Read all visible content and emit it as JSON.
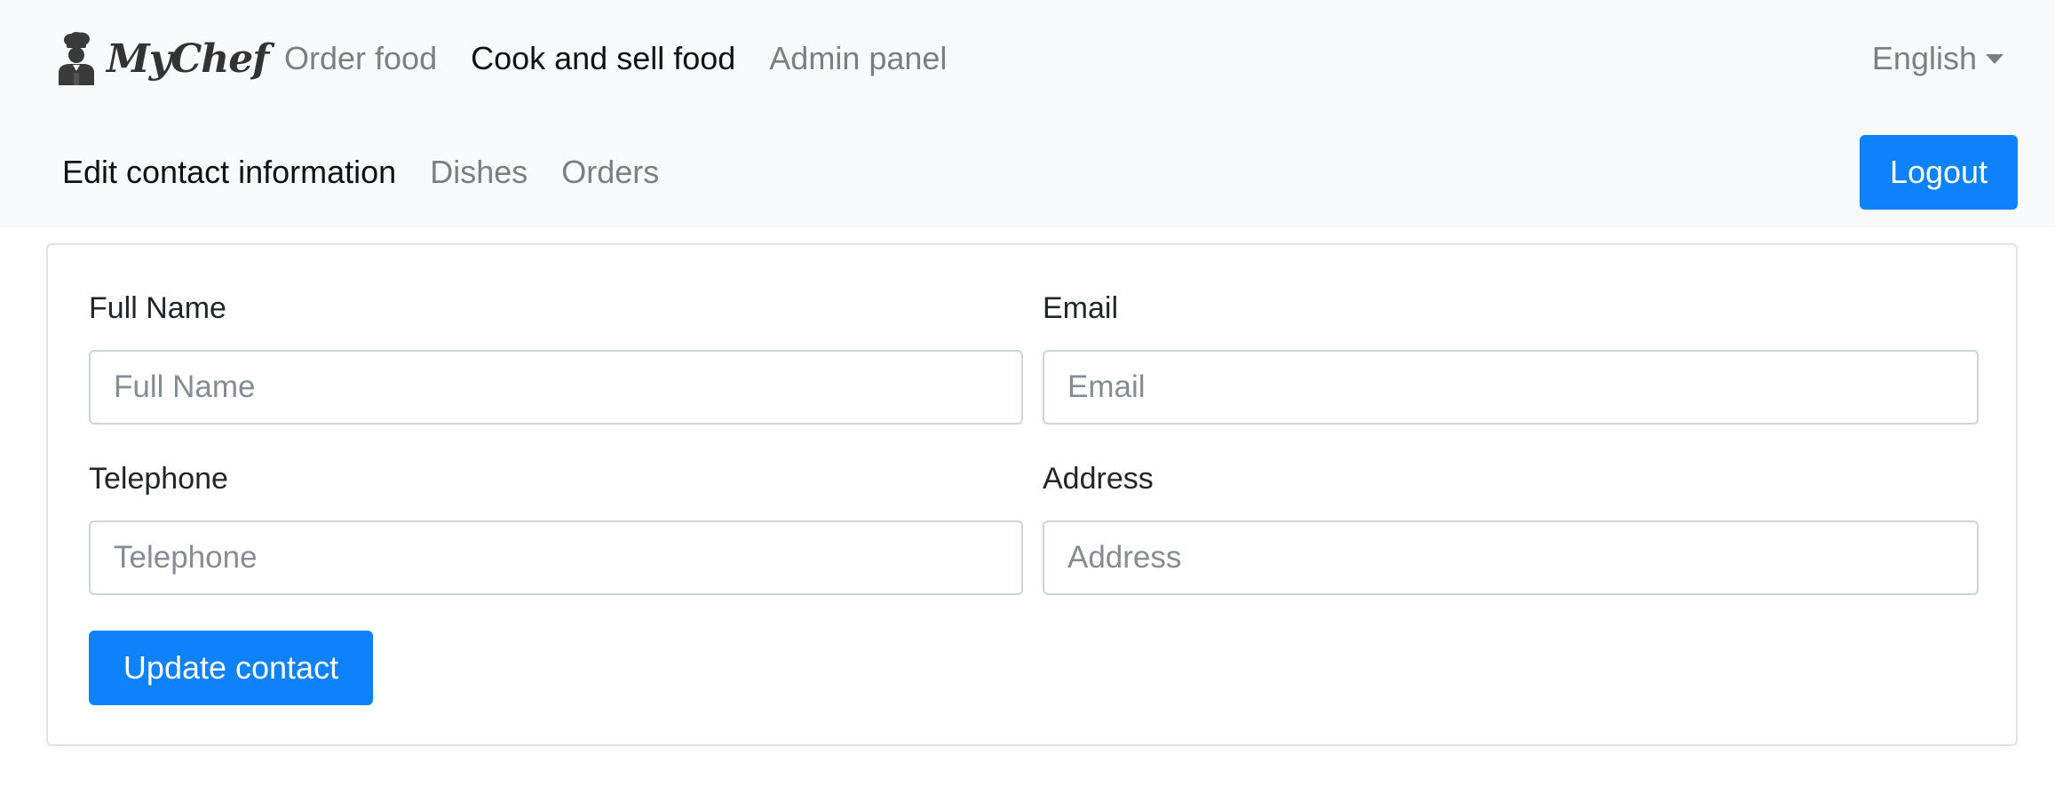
{
  "brand": {
    "name": "MyChef",
    "logo_icon": "chef-icon"
  },
  "main_nav": [
    {
      "label": "Order food",
      "active": false
    },
    {
      "label": "Cook and sell food",
      "active": true
    },
    {
      "label": "Admin panel",
      "active": false
    }
  ],
  "language": {
    "selected": "English",
    "icon": "caret-down-icon"
  },
  "sub_nav": [
    {
      "label": "Edit contact information",
      "active": true
    },
    {
      "label": "Dishes",
      "active": false
    },
    {
      "label": "Orders",
      "active": false
    }
  ],
  "logout_label": "Logout",
  "form": {
    "full_name": {
      "label": "Full Name",
      "placeholder": "Full Name",
      "value": ""
    },
    "email": {
      "label": "Email",
      "placeholder": "Email",
      "value": ""
    },
    "telephone": {
      "label": "Telephone",
      "placeholder": "Telephone",
      "value": ""
    },
    "address": {
      "label": "Address",
      "placeholder": "Address",
      "value": ""
    },
    "submit_label": "Update contact"
  },
  "colors": {
    "primary": "#0d82fb",
    "navbar_bg": "#f8f9fa",
    "nav_muted": "#7b7f83",
    "nav_active": "#111111"
  }
}
